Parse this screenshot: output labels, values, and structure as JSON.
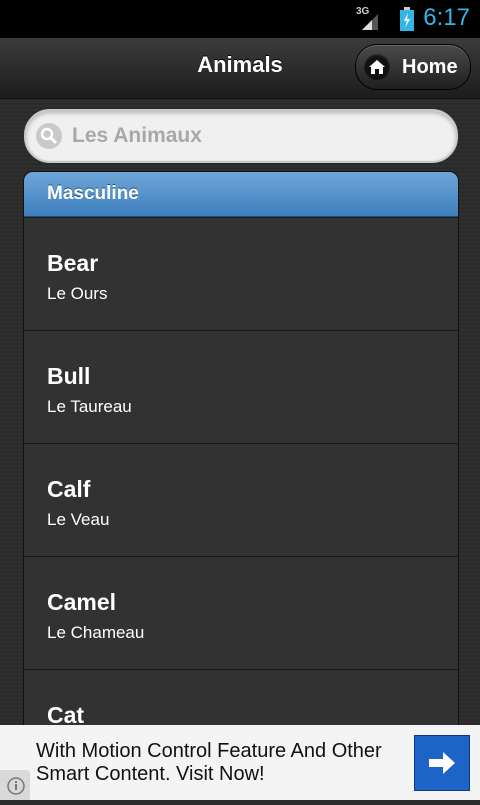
{
  "status_bar": {
    "network": "3G",
    "time": "6:17"
  },
  "header": {
    "title": "Animals",
    "home_label": "Home"
  },
  "search": {
    "placeholder": "Les Animaux"
  },
  "list": {
    "divider": "Masculine",
    "items": [
      {
        "name": "Bear",
        "translation": "Le Ours"
      },
      {
        "name": "Bull",
        "translation": "Le Taureau"
      },
      {
        "name": "Calf",
        "translation": "Le Veau"
      },
      {
        "name": "Camel",
        "translation": "Le Chameau"
      },
      {
        "name": "Cat",
        "translation": ""
      }
    ]
  },
  "ad": {
    "text": "With Motion Control Feature And Other Smart Content. Visit Now!"
  },
  "colors": {
    "accent": "#33b5e5",
    "divider": "#4f8fcc",
    "ad_button": "#1e63c8"
  }
}
